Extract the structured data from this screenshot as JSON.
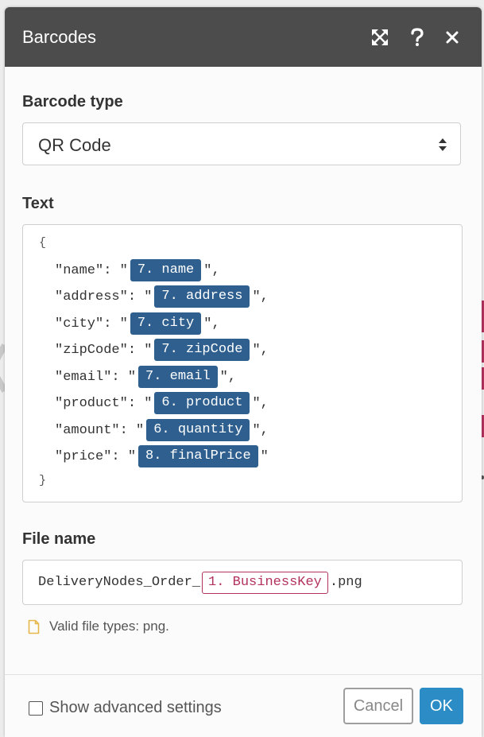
{
  "dialog": {
    "title": "Barcodes",
    "icons": [
      "expand-icon",
      "help-icon",
      "close-icon"
    ]
  },
  "barcode_type": {
    "label": "Barcode type",
    "value": "QR Code"
  },
  "text_field": {
    "label": "Text",
    "open_brace": "{",
    "close_brace": "}",
    "lines": [
      {
        "key": "\"name\": \"",
        "token": "7. name",
        "tail": "\","
      },
      {
        "key": "\"address\": \"",
        "token": "7. address",
        "tail": "\","
      },
      {
        "key": "\"city\": \"",
        "token": "7. city",
        "tail": "\","
      },
      {
        "key": "\"zipCode\": \"",
        "token": "7. zipCode",
        "tail": "\","
      },
      {
        "key": "\"email\": \"",
        "token": "7. email",
        "tail": "\","
      },
      {
        "key": "\"product\": \"",
        "token": "6. product",
        "tail": "\","
      },
      {
        "key": "\"amount\": \"",
        "token": "6. quantity",
        "tail": "\","
      },
      {
        "key": "\"price\": \"",
        "token": "8. finalPrice",
        "tail": "\""
      }
    ]
  },
  "file_name": {
    "label": "File name",
    "prefix": "DeliveryNodes_Order_",
    "token": "1. BusinessKey",
    "suffix": ".png",
    "hint": "Valid file types: png."
  },
  "footer": {
    "advanced_label": "Show advanced settings",
    "advanced_checked": false,
    "cancel_label": "Cancel",
    "ok_label": "OK"
  },
  "colors": {
    "titlebar": "#4c4c4c",
    "token_fill": "#2e5f8f",
    "token_outline": "#b3325d",
    "ok_button": "#2c8dc6"
  }
}
